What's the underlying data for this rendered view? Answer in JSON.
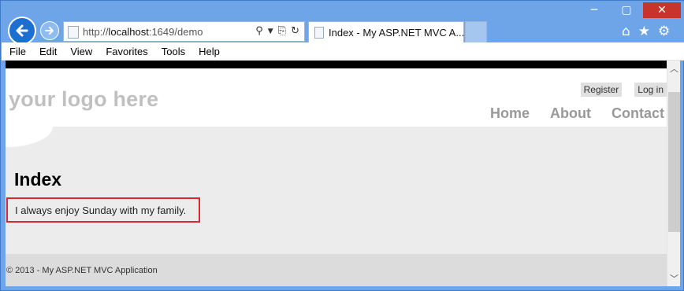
{
  "browser": {
    "address": {
      "url_prefix": "http://",
      "url_host": "localhost",
      "url_rest": ":1649/demo",
      "search_icon": "search-icon",
      "refresh_icon": "refresh-icon"
    },
    "tab": {
      "title": "Index - My ASP.NET MVC A..."
    },
    "right_icons": {
      "home": "⌂",
      "favorites": "★",
      "settings": "⚙"
    },
    "window": {
      "minimize": "─",
      "maximize": "▢",
      "close": "✕"
    },
    "menu": [
      "File",
      "Edit",
      "View",
      "Favorites",
      "Tools",
      "Help"
    ]
  },
  "site": {
    "logo": "your logo here",
    "login_links": [
      "Register",
      "Log in"
    ],
    "nav": [
      "Home",
      "About",
      "Contact"
    ],
    "page_title": "Index",
    "message": "I always enjoy Sunday with my family.",
    "footer": "© 2013 - My ASP.NET MVC Application"
  },
  "colors": {
    "frame": "#6ea5e8",
    "highlight_border": "#d8282f",
    "close": "#c7342a"
  }
}
